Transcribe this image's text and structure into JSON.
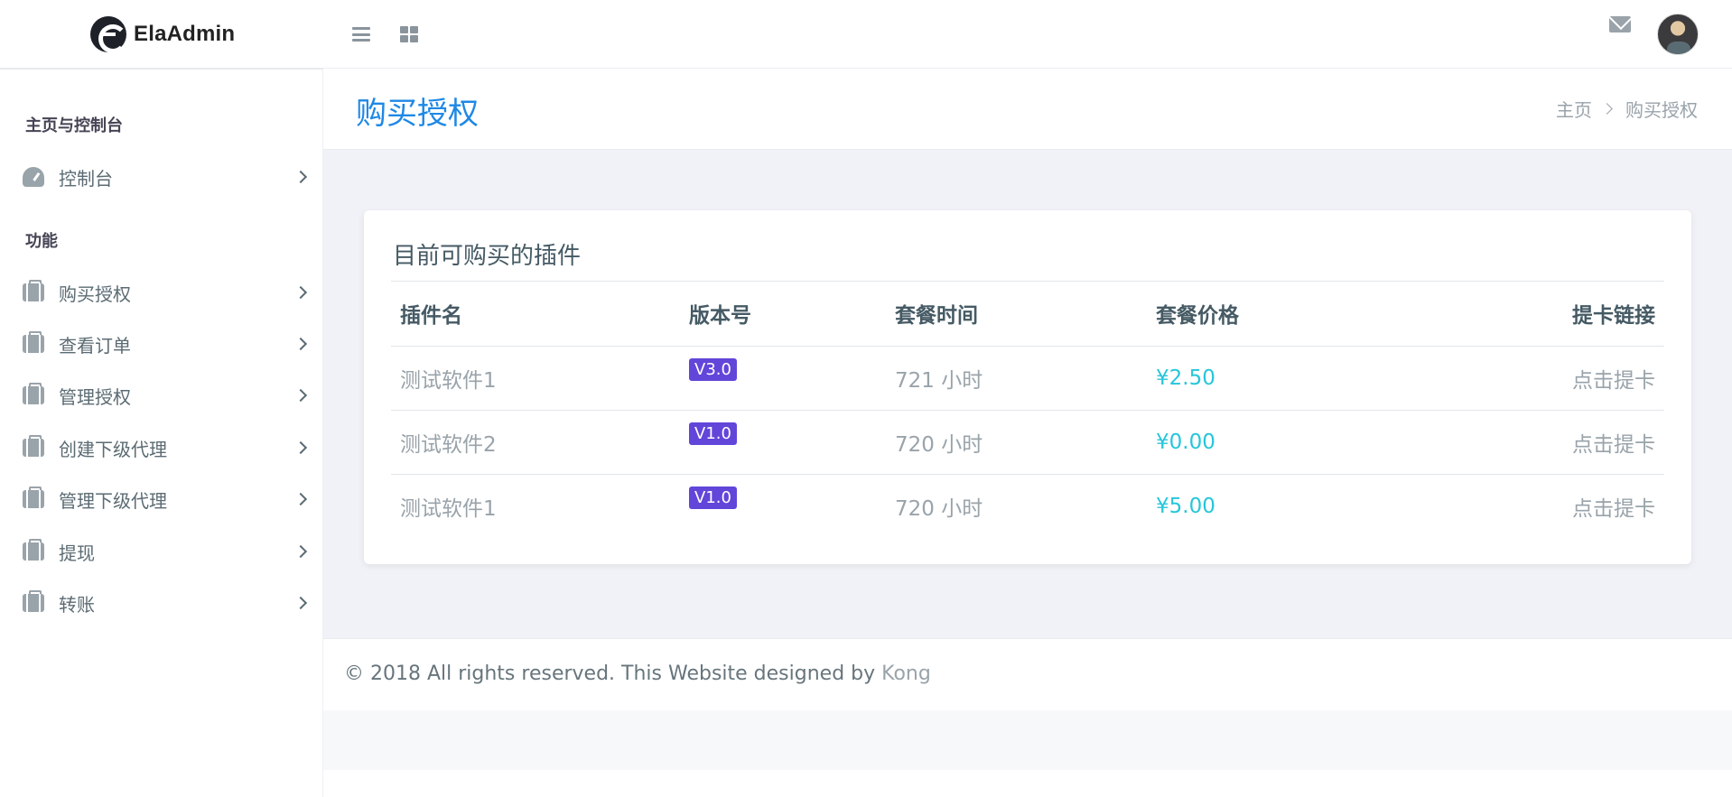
{
  "header": {
    "logo_text": "ElaAdmin",
    "menu_toggle_icon": "hamburger-icon",
    "grid_icon": "grid-icon",
    "mail_icon": "envelope-icon",
    "avatar_icon": "user-avatar"
  },
  "sidebar": {
    "section_main": "主页与控制台",
    "dashboard_label": "控制台",
    "section_features": "功能",
    "items": [
      {
        "label": "购买授权",
        "icon": "briefcase-icon"
      },
      {
        "label": "查看订单",
        "icon": "briefcase-icon"
      },
      {
        "label": "管理授权",
        "icon": "briefcase-icon"
      },
      {
        "label": "创建下级代理",
        "icon": "briefcase-icon"
      },
      {
        "label": "管理下级代理",
        "icon": "briefcase-icon"
      },
      {
        "label": "提现",
        "icon": "briefcase-icon"
      },
      {
        "label": "转账",
        "icon": "briefcase-icon"
      }
    ]
  },
  "page": {
    "title": "购买授权",
    "breadcrumb": {
      "home": "主页",
      "current": "购买授权"
    }
  },
  "card": {
    "title": "目前可购买的插件",
    "columns": [
      "插件名",
      "版本号",
      "套餐时间",
      "套餐价格",
      "提卡链接"
    ],
    "rows": [
      {
        "name": "测试软件1",
        "version": "V3.0",
        "time": "721 小时",
        "price": "¥2.50",
        "link": "点击提卡"
      },
      {
        "name": "测试软件2",
        "version": "V1.0",
        "time": "720 小时",
        "price": "¥0.00",
        "link": "点击提卡"
      },
      {
        "name": "测试软件1",
        "version": "V1.0",
        "time": "720 小时",
        "price": "¥5.00",
        "link": "点击提卡"
      }
    ]
  },
  "footer": {
    "text": "© 2018 All rights reserved. This Website designed by ",
    "link": "Kong"
  },
  "colors": {
    "accent": "#1e88e5",
    "badge": "#6146d9",
    "price": "#26c6da"
  }
}
